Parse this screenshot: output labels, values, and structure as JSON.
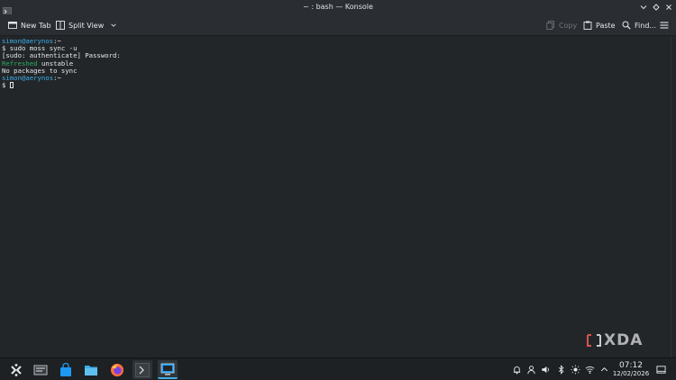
{
  "window": {
    "title": "~ : bash — Konsole"
  },
  "toolbar": {
    "new_tab": "New Tab",
    "split_view": "Split View",
    "copy": "Copy",
    "paste": "Paste",
    "find": "Find..."
  },
  "terminal": {
    "lines": [
      {
        "user": "simon@aerynos",
        "suffix": ":~"
      },
      {
        "text": "$ sudo moss sync -u"
      },
      {
        "text": "[sudo: authenticate] Password:"
      },
      {
        "green": "Refreshed",
        "text": " unstable"
      },
      {
        "text": "No packages to sync"
      },
      {
        "user": "simon@aerynos",
        "suffix": ":~"
      },
      {
        "text": "$ "
      }
    ]
  },
  "watermark": {
    "text": "XDA"
  },
  "clock": {
    "time": "07:12",
    "date": "12/02/2026"
  },
  "colors": {
    "accent": "#3daee9",
    "green": "#27ae60",
    "bg": "#232629",
    "panel": "#1e2124"
  }
}
